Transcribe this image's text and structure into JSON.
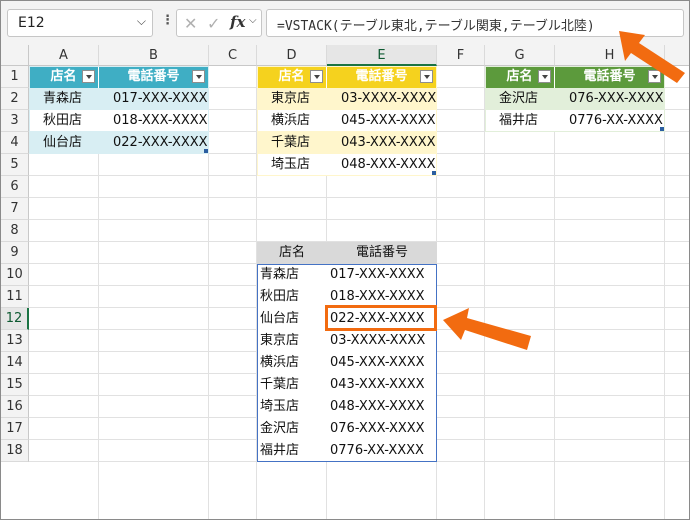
{
  "name_box": "E12",
  "formula": "=VSTACK(テーブル東北,テーブル関東,テーブル北陸)",
  "columns": [
    "A",
    "B",
    "C",
    "D",
    "E",
    "F",
    "G",
    "H"
  ],
  "rows": [
    "1",
    "2",
    "3",
    "4",
    "5",
    "6",
    "7",
    "8",
    "9",
    "10",
    "11",
    "12",
    "13",
    "14",
    "15",
    "16",
    "17",
    "18"
  ],
  "table_tohoku": {
    "headers": [
      "店名",
      "電話番号"
    ],
    "rows": [
      [
        "青森店",
        "017-XXX-XXXX"
      ],
      [
        "秋田店",
        "018-XXX-XXXX"
      ],
      [
        "仙台店",
        "022-XXX-XXXX"
      ]
    ],
    "header_color": "#3faec4",
    "band_color": "#d8eef3"
  },
  "table_kanto": {
    "headers": [
      "店名",
      "電話番号"
    ],
    "rows": [
      [
        "東京店",
        "03-XXXX-XXXX"
      ],
      [
        "横浜店",
        "045-XXX-XXXX"
      ],
      [
        "千葉店",
        "043-XXX-XXXX"
      ],
      [
        "埼玉店",
        "048-XXX-XXXX"
      ]
    ],
    "header_color": "#f5d21e",
    "band_color": "#fff6cc"
  },
  "table_hokuriku": {
    "headers": [
      "店名",
      "電話番号"
    ],
    "rows": [
      [
        "金沢店",
        "076-XXX-XXXX"
      ],
      [
        "福井店",
        "0776-XX-XXXX"
      ]
    ],
    "header_color": "#5c9a3c",
    "band_color": "#e2efda"
  },
  "result": {
    "headers": [
      "店名",
      "電話番号"
    ],
    "rows": [
      [
        "青森店",
        "017-XXX-XXXX"
      ],
      [
        "秋田店",
        "018-XXX-XXXX"
      ],
      [
        "仙台店",
        "022-XXX-XXXX"
      ],
      [
        "東京店",
        "03-XXXX-XXXX"
      ],
      [
        "横浜店",
        "045-XXX-XXXX"
      ],
      [
        "千葉店",
        "043-XXX-XXXX"
      ],
      [
        "埼玉店",
        "048-XXX-XXXX"
      ],
      [
        "金沢店",
        "076-XXX-XXXX"
      ],
      [
        "福井店",
        "0776-XX-XXXX"
      ]
    ]
  },
  "accent_color": "#f26b10",
  "selection_color": "#1a7343"
}
